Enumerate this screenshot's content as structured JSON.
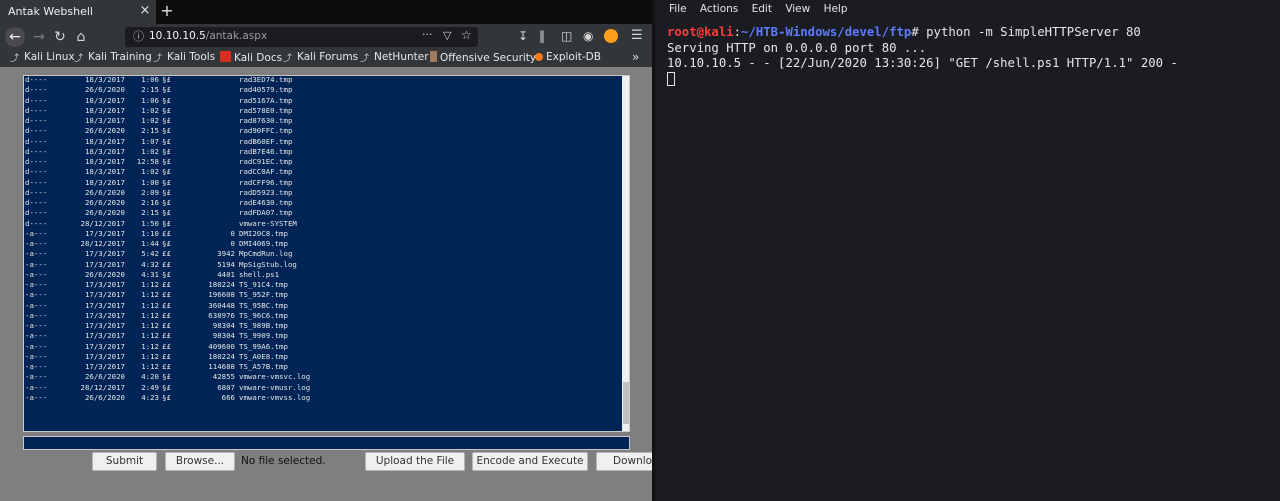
{
  "browser": {
    "tab_title": "Antak Webshell",
    "tab_close": "×",
    "new_tab": "+",
    "url_host": "10.10.10.5",
    "url_path": "/antak.aspx",
    "url_more": "···",
    "bookmarks": [
      {
        "label": "Kali Linux",
        "icon": "kali-dragon-icon"
      },
      {
        "label": "Kali Training",
        "icon": "kali-dragon-icon"
      },
      {
        "label": "Kali Tools",
        "icon": "kali-dragon-icon"
      },
      {
        "label": "Kali Docs",
        "icon": "kali-docs-icon"
      },
      {
        "label": "Kali Forums",
        "icon": "kali-dragon-icon"
      },
      {
        "label": "NetHunter",
        "icon": "nethunter-icon"
      },
      {
        "label": "Offensive Security",
        "icon": "offsec-icon"
      },
      {
        "label": "Exploit-DB",
        "icon": "exploit-db-icon"
      }
    ],
    "bookmarks_more": "»"
  },
  "console_rows": [
    {
      "mode": "d----",
      "date": "18/3/2017",
      "time": "1:06",
      "ampm": "§£",
      "length": "",
      "name": "rad3ED74.tmp"
    },
    {
      "mode": "d----",
      "date": "26/6/2020",
      "time": "2:15",
      "ampm": "§£",
      "length": "",
      "name": "rad40579.tmp"
    },
    {
      "mode": "d----",
      "date": "18/3/2017",
      "time": "1:06",
      "ampm": "§£",
      "length": "",
      "name": "rad5167A.tmp"
    },
    {
      "mode": "d----",
      "date": "18/3/2017",
      "time": "1:02",
      "ampm": "§£",
      "length": "",
      "name": "rad578E0.tmp"
    },
    {
      "mode": "d----",
      "date": "18/3/2017",
      "time": "1:02",
      "ampm": "§£",
      "length": "",
      "name": "rad87630.tmp"
    },
    {
      "mode": "d----",
      "date": "26/6/2020",
      "time": "2:15",
      "ampm": "§£",
      "length": "",
      "name": "rad90FFC.tmp"
    },
    {
      "mode": "d----",
      "date": "18/3/2017",
      "time": "1:07",
      "ampm": "§£",
      "length": "",
      "name": "radB60EF.tmp"
    },
    {
      "mode": "d----",
      "date": "18/3/2017",
      "time": "1:02",
      "ampm": "§£",
      "length": "",
      "name": "radB7E46.tmp"
    },
    {
      "mode": "d----",
      "date": "18/3/2017",
      "time": "12:58",
      "ampm": "§£",
      "length": "",
      "name": "radC91EC.tmp"
    },
    {
      "mode": "d----",
      "date": "18/3/2017",
      "time": "1:02",
      "ampm": "§£",
      "length": "",
      "name": "radCC0AF.tmp"
    },
    {
      "mode": "d----",
      "date": "18/3/2017",
      "time": "1:00",
      "ampm": "§£",
      "length": "",
      "name": "radCFF96.tmp"
    },
    {
      "mode": "d----",
      "date": "26/6/2020",
      "time": "2:09",
      "ampm": "§£",
      "length": "",
      "name": "radD5923.tmp"
    },
    {
      "mode": "d----",
      "date": "26/6/2020",
      "time": "2:16",
      "ampm": "§£",
      "length": "",
      "name": "radE4630.tmp"
    },
    {
      "mode": "d----",
      "date": "26/6/2020",
      "time": "2:15",
      "ampm": "§£",
      "length": "",
      "name": "radFDA07.tmp"
    },
    {
      "mode": "d----",
      "date": "28/12/2017",
      "time": "1:50",
      "ampm": "§£",
      "length": "",
      "name": "vmware-SYSTEM"
    },
    {
      "mode": "-a---",
      "date": "17/3/2017",
      "time": "1:10",
      "ampm": "££",
      "length": "0",
      "name": "DMI20C8.tmp"
    },
    {
      "mode": "-a---",
      "date": "28/12/2017",
      "time": "1:44",
      "ampm": "§£",
      "length": "0",
      "name": "DMI4069.tmp"
    },
    {
      "mode": "-a---",
      "date": "17/3/2017",
      "time": "5:42",
      "ampm": "££",
      "length": "3942",
      "name": "MpCmdRun.log"
    },
    {
      "mode": "-a---",
      "date": "17/3/2017",
      "time": "4:32",
      "ampm": "££",
      "length": "5194",
      "name": "MpSigStub.log"
    },
    {
      "mode": "-a---",
      "date": "26/6/2020",
      "time": "4:31",
      "ampm": "§£",
      "length": "4401",
      "name": "shell.ps1"
    },
    {
      "mode": "-a---",
      "date": "17/3/2017",
      "time": "1:12",
      "ampm": "££",
      "length": "180224",
      "name": "TS_91C4.tmp"
    },
    {
      "mode": "-a---",
      "date": "17/3/2017",
      "time": "1:12",
      "ampm": "££",
      "length": "196608",
      "name": "TS_952F.tmp"
    },
    {
      "mode": "-a---",
      "date": "17/3/2017",
      "time": "1:12",
      "ampm": "££",
      "length": "360448",
      "name": "TS_95BC.tmp"
    },
    {
      "mode": "-a---",
      "date": "17/3/2017",
      "time": "1:12",
      "ampm": "££",
      "length": "638976",
      "name": "TS_96C6.tmp"
    },
    {
      "mode": "-a---",
      "date": "17/3/2017",
      "time": "1:12",
      "ampm": "££",
      "length": "98304",
      "name": "TS_989B.tmp"
    },
    {
      "mode": "-a---",
      "date": "17/3/2017",
      "time": "1:12",
      "ampm": "££",
      "length": "98304",
      "name": "TS_9909.tmp"
    },
    {
      "mode": "-a---",
      "date": "17/3/2017",
      "time": "1:12",
      "ampm": "££",
      "length": "409600",
      "name": "TS_99A6.tmp"
    },
    {
      "mode": "-a---",
      "date": "17/3/2017",
      "time": "1:12",
      "ampm": "££",
      "length": "180224",
      "name": "TS_A0E8.tmp"
    },
    {
      "mode": "-a---",
      "date": "17/3/2017",
      "time": "1:12",
      "ampm": "££",
      "length": "114688",
      "name": "TS_A57B.tmp"
    },
    {
      "mode": "-a---",
      "date": "26/6/2020",
      "time": "4:20",
      "ampm": "§£",
      "length": "42855",
      "name": "vmware-vmsvc.log"
    },
    {
      "mode": "-a---",
      "date": "28/12/2017",
      "time": "2:49",
      "ampm": "§£",
      "length": "6807",
      "name": "vmware-vmusr.log"
    },
    {
      "mode": "-a---",
      "date": "26/6/2020",
      "time": "4:23",
      "ampm": "§£",
      "length": "666",
      "name": "vmware-vmvss.log"
    }
  ],
  "webshell": {
    "submit_label": "Submit",
    "browse_label": "Browse...",
    "file_status": "No file selected.",
    "upload_label": "Upload the File",
    "encode_label": "Encode and Execute",
    "download_label": "Download"
  },
  "terminal": {
    "menu": [
      "File",
      "Actions",
      "Edit",
      "View",
      "Help"
    ],
    "prompt_user": "root@kali",
    "prompt_sep": ":",
    "prompt_path": "~/HTB-Windows/devel/ftp",
    "prompt_end": "# ",
    "command": "python -m SimpleHTTPServer 80",
    "output": [
      "Serving HTTP on 0.0.0.0 port 80 ...",
      "10.10.10.5 - - [22/Jun/2020 13:30:26] \"GET /shell.ps1 HTTP/1.1\" 200 -"
    ]
  }
}
